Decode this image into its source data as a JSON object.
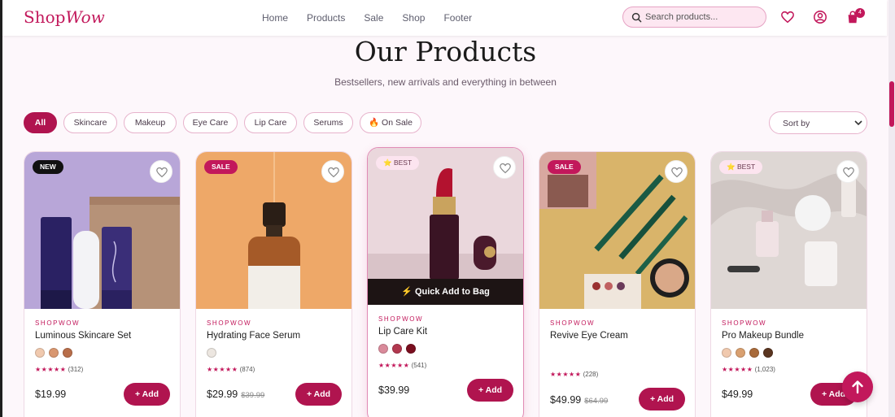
{
  "brand": {
    "prefix": "Shop",
    "suffix": "Wow"
  },
  "nav": {
    "links": [
      "Home",
      "Products",
      "Sale",
      "Shop",
      "Footer"
    ]
  },
  "search": {
    "placeholder": "Search products..."
  },
  "cart": {
    "count": "4"
  },
  "page": {
    "title": "Our Products",
    "subtitle": "Bestsellers, new arrivals and everything in between"
  },
  "filters": [
    "All",
    "Skincare",
    "Makeup",
    "Eye Care",
    "Lip Care",
    "Serums",
    "🔥 On Sale"
  ],
  "sort": {
    "label": "Sort by"
  },
  "quick_add_label": "⚡ Quick Add to Bag",
  "add_label": "+ Add",
  "products": [
    {
      "badge": "NEW",
      "badge_type": "new",
      "vendor": "SHOPWOW",
      "name": "Luminous Skincare Set",
      "swatches": [
        "#f0c9ae",
        "#d99770",
        "#b86e4a"
      ],
      "stars": "★★★★★",
      "reviews": "(312)",
      "price": "$19.99",
      "old_price": ""
    },
    {
      "badge": "SALE",
      "badge_type": "sale",
      "vendor": "SHOPWOW",
      "name": "Hydrating Face Serum",
      "swatches": [
        "#ece6e0"
      ],
      "stars": "★★★★★",
      "reviews": "(874)",
      "price": "$29.99",
      "old_price": "$39.99"
    },
    {
      "badge": "⭐ BEST",
      "badge_type": "best",
      "vendor": "SHOPWOW",
      "name": "Lip Care Kit",
      "swatches": [
        "#d98a9a",
        "#b2384f",
        "#7a0e1f"
      ],
      "stars": "★★★★★",
      "reviews": "(541)",
      "price": "$39.99",
      "old_price": ""
    },
    {
      "badge": "SALE",
      "badge_type": "sale",
      "vendor": "SHOPWOW",
      "name": "Revive Eye Cream",
      "swatches": [],
      "stars": "★★★★★",
      "reviews": "(228)",
      "price": "$49.99",
      "old_price": "$64.99"
    },
    {
      "badge": "⭐ BEST",
      "badge_type": "best",
      "vendor": "SHOPWOW",
      "name": "Pro Makeup Bundle",
      "swatches": [
        "#f0c9ae",
        "#d9a070",
        "#a86a3a",
        "#5a3520"
      ],
      "stars": "★★★★★",
      "reviews": "(1,023)",
      "price": "$49.99",
      "old_price": ""
    }
  ],
  "icons": {
    "search": "search-icon",
    "wishlist": "heart-icon",
    "account": "user-icon",
    "cart": "bag-icon",
    "sort": "chevron-down-icon",
    "scroll_top": "arrow-up-icon"
  },
  "colors": {
    "accent": "#c2185b",
    "accent_dark": "#b0144f",
    "background": "#fdf7fb"
  }
}
